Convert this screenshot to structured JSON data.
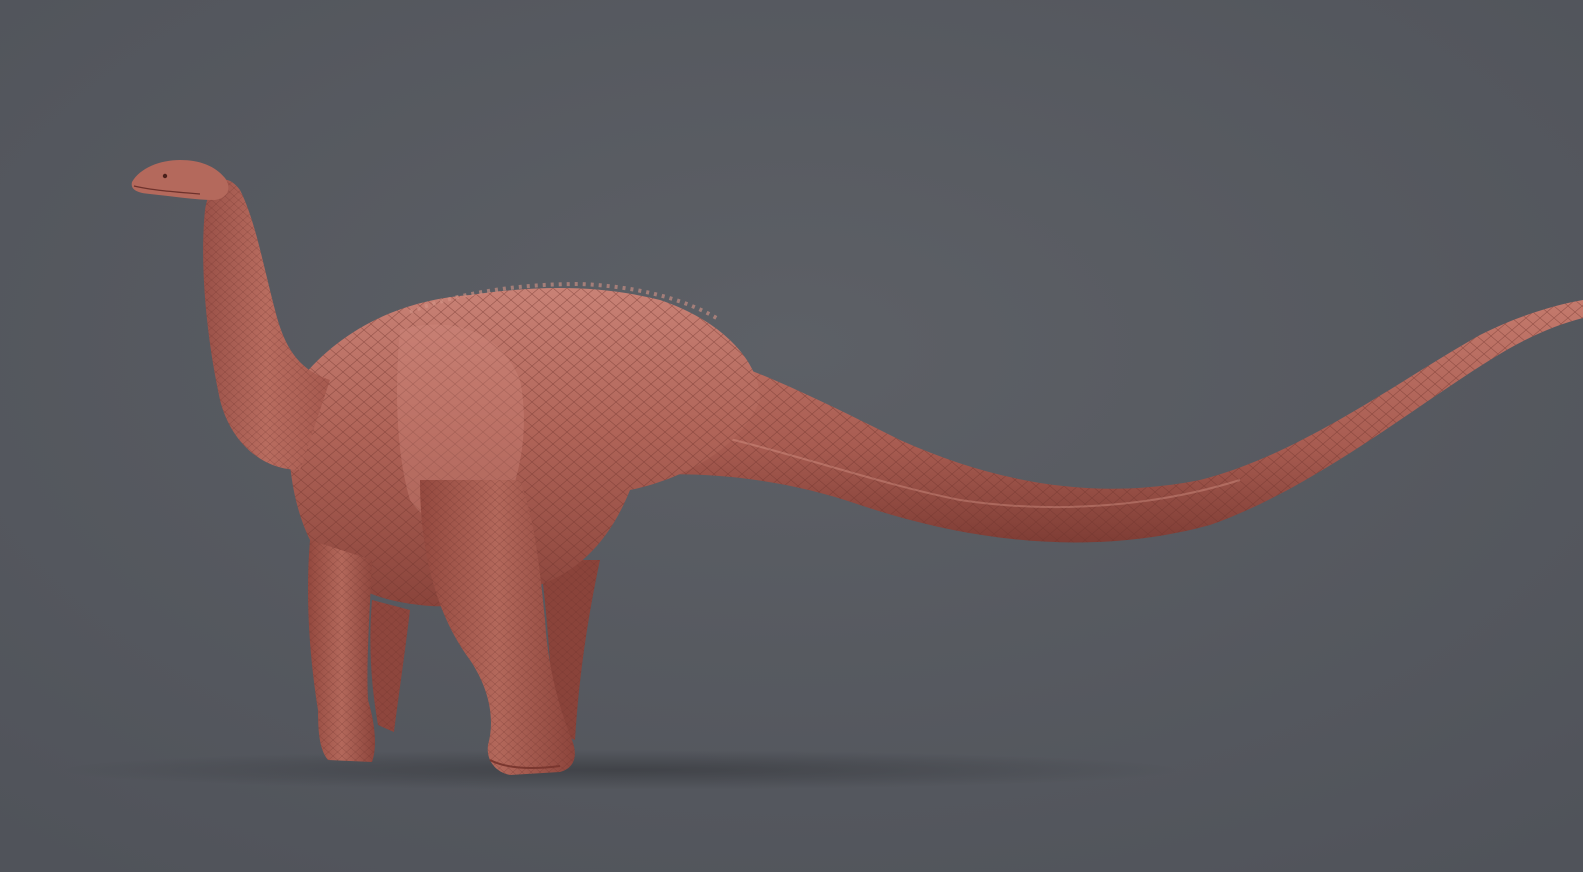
{
  "scene": {
    "subject_icon": "sauropod-dinosaur-icon",
    "colors": {
      "background": "#55585e",
      "background_light": "#5d6066",
      "skin_base": "#b06458",
      "skin_light": "#c97d70",
      "skin_dark": "#7c3a33",
      "shadow": "#3c3e43"
    }
  }
}
